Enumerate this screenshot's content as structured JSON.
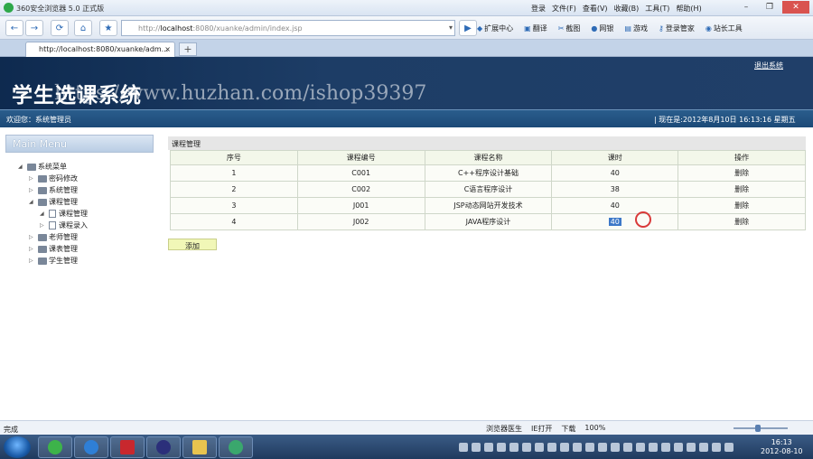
{
  "browser": {
    "title": "360安全浏览器 5.0 正式版",
    "menus": [
      "登录",
      "文件(F)",
      "查看(V)",
      "收藏(B)",
      "工具(T)",
      "帮助(H)"
    ],
    "address_prefix": "http://",
    "address_host": "localhost",
    "address_rest": ":8080/xuanke/admin/index.jsp",
    "tools": [
      "扩展中心",
      "翻译",
      "截图",
      "网银",
      "游戏",
      "登录管家",
      "站长工具"
    ],
    "tab_label": "http://localhost:8080/xuanke/adm...",
    "tab_close": "×"
  },
  "app": {
    "title": "学生选课系统",
    "watermark": "https://www.huzhan.com/ishop39397",
    "logout": "退出系统",
    "welcome": "欢迎您：系统管理员",
    "now": "| 现在是:2012年8月10日  16:13:16 星期五"
  },
  "sidebar": {
    "title": "Main Menu",
    "items": [
      {
        "label": "系统菜单",
        "level": 0,
        "type": "folder",
        "toggle": "◢"
      },
      {
        "label": "密码修改",
        "level": 1,
        "type": "folder",
        "toggle": "▷"
      },
      {
        "label": "系统管理",
        "level": 1,
        "type": "folder",
        "toggle": "▷"
      },
      {
        "label": "课程管理",
        "level": 1,
        "type": "folder",
        "toggle": "◢"
      },
      {
        "label": "课程管理",
        "level": 2,
        "type": "page",
        "toggle": "◢"
      },
      {
        "label": "课程录入",
        "level": 2,
        "type": "page",
        "toggle": "▷"
      },
      {
        "label": "老师管理",
        "level": 1,
        "type": "folder",
        "toggle": "▷"
      },
      {
        "label": "课表管理",
        "level": 1,
        "type": "folder",
        "toggle": "▷"
      },
      {
        "label": "学生管理",
        "level": 1,
        "type": "folder",
        "toggle": "▷"
      }
    ]
  },
  "content": {
    "section_title": "课程管理",
    "columns": [
      "序号",
      "课程编号",
      "课程名称",
      "课时",
      "操作"
    ],
    "rows": [
      [
        "1",
        "C001",
        "C++程序设计基础",
        "40",
        "删除"
      ],
      [
        "2",
        "C002",
        "C语言程序设计",
        "38",
        "删除"
      ],
      [
        "3",
        "J001",
        "JSP动态网站开发技术",
        "40",
        "删除"
      ],
      [
        "4",
        "J002",
        "JAVA程序设计",
        "40",
        "删除"
      ]
    ],
    "add_label": "添加"
  },
  "statusbar": {
    "left": "完成",
    "items": [
      "浏览器医生",
      "IE打开",
      "下载",
      "100%"
    ]
  },
  "taskbar": {
    "time": "16:13",
    "date": "2012-08-10"
  }
}
